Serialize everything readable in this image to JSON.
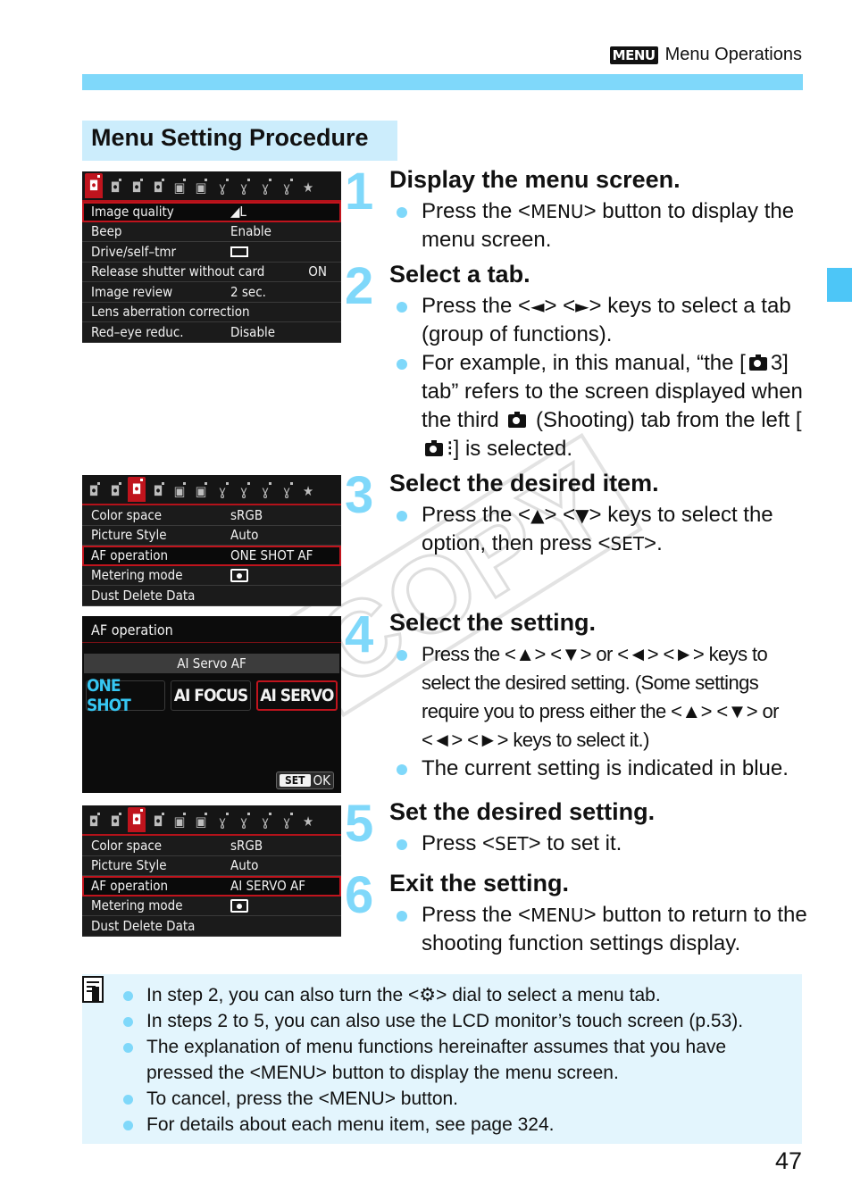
{
  "header": {
    "badge": "MENU",
    "title": "Menu Operations"
  },
  "colors": {
    "accent": "#7fd8fa",
    "section_bg": "#ccedfc",
    "note_bg": "#e3f5fd",
    "lcd_red": "#c0141d",
    "lcd_current_blue": "#36c6f2"
  },
  "section_title": "Menu Setting Procedure",
  "watermark": "COPY",
  "screens": {
    "screen1": {
      "active_tab": 1,
      "rows": [
        {
          "label": "Image quality",
          "value": "◢L",
          "selected": true
        },
        {
          "label": "Beep",
          "value": "Enable"
        },
        {
          "label": "Drive/self–tmr",
          "value": "single-shot-icon"
        },
        {
          "label": "Release shutter without card",
          "value": "ON"
        },
        {
          "label": "Image review",
          "value": "2 sec."
        },
        {
          "label": "Lens aberration correction",
          "value": ""
        },
        {
          "label": "Red–eye reduc.",
          "value": "Disable"
        }
      ]
    },
    "screen3": {
      "active_tab": 3,
      "rows": [
        {
          "label": "Color space",
          "value": "sRGB"
        },
        {
          "label": "Picture Style",
          "value": "Auto"
        },
        {
          "label": "AF operation",
          "value": "ONE SHOT AF",
          "selected": true
        },
        {
          "label": "Metering mode",
          "value": "evaluative-metering-icon"
        },
        {
          "label": "Dust Delete Data",
          "value": ""
        }
      ]
    },
    "screen4": {
      "title": "AF operation",
      "current_label": "AI Servo AF",
      "options": [
        "ONE SHOT",
        "AI FOCUS",
        "AI SERVO"
      ],
      "current_option": "ONE SHOT",
      "selected_option": "AI SERVO",
      "ok_set": "SET",
      "ok_label": "OK"
    },
    "screen5": {
      "active_tab": 3,
      "rows": [
        {
          "label": "Color space",
          "value": "sRGB"
        },
        {
          "label": "Picture Style",
          "value": "Auto"
        },
        {
          "label": "AF operation",
          "value": "AI SERVO AF",
          "selected": true
        },
        {
          "label": "Metering mode",
          "value": "evaluative-metering-icon"
        },
        {
          "label": "Dust Delete Data",
          "value": ""
        }
      ]
    }
  },
  "steps": [
    {
      "num": "1",
      "title": "Display the menu screen.",
      "bullets": [
        {
          "parts": [
            "Press the <",
            "MENU",
            "> button to display the menu screen."
          ]
        }
      ]
    },
    {
      "num": "2",
      "title": "Select a tab.",
      "bullets": [
        {
          "parts": [
            "Press the <",
            "◄",
            "> <",
            "►",
            "> keys to select a tab (group of functions)."
          ]
        },
        {
          "parts": [
            "For example, in this manual, “the [",
            "camera-icon",
            "3] tab” refers to the screen displayed when the third ",
            "camera-icon",
            " (Shooting) tab from the left [",
            "camera-icon",
            "⁝] is selected."
          ]
        }
      ]
    },
    {
      "num": "3",
      "title": "Select the desired item.",
      "bullets": [
        {
          "parts": [
            "Press the <",
            "▲",
            "> <",
            "▼",
            "> keys to select the option, then press <",
            "SET",
            ">."
          ]
        }
      ]
    },
    {
      "num": "4",
      "title": "Select the setting.",
      "bullets": [
        {
          "parts": [
            "Press the <▲> <▼> or <◄> <►> keys to select the desired setting. (Some settings require you to press either the <▲> <▼> or <◄> <►> keys to select it.)"
          ]
        },
        {
          "parts": [
            "The current setting is indicated in blue."
          ]
        }
      ]
    },
    {
      "num": "5",
      "title": "Set the desired setting.",
      "bullets": [
        {
          "parts": [
            "Press <",
            "SET",
            "> to set it."
          ]
        }
      ]
    },
    {
      "num": "6",
      "title": "Exit the setting.",
      "bullets": [
        {
          "parts": [
            "Press the <",
            "MENU",
            "> button to return to the shooting function settings display."
          ]
        }
      ]
    }
  ],
  "notes": [
    "In step 2, you can also turn the <⚙> dial to select a menu tab.",
    "In steps 2 to 5, you can also use the LCD monitor’s touch screen (p.53).",
    "The explanation of menu functions hereinafter assumes that you have",
    "pressed the <MENU> button to display the menu screen.",
    "To cancel, press the <MENU> button.",
    "For details about each menu item, see page 324."
  ],
  "page_number": "47"
}
